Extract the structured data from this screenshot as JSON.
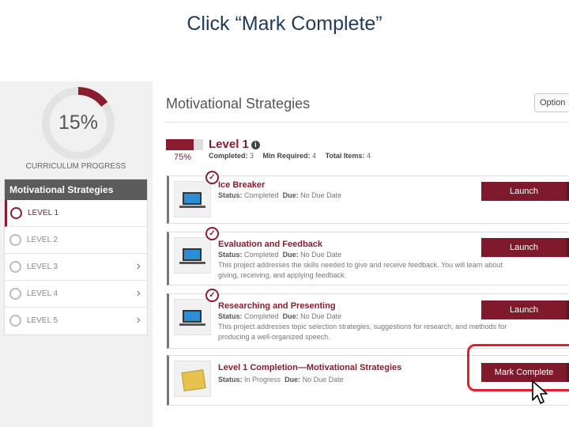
{
  "slide_title": "Click “Mark Complete”",
  "colors": {
    "accent": "#8a1c2f",
    "button": "#7e1a2c",
    "highlight": "#e0202f",
    "title": "#1f3a5b"
  },
  "progress": {
    "percent_label": "15%",
    "value": 0.15,
    "label": "CURRICULUM PROGRESS"
  },
  "sidebar": {
    "header": "Motivational Strategies",
    "levels": [
      {
        "label": "LEVEL 1",
        "active": true,
        "chevron": false
      },
      {
        "label": "LEVEL 2",
        "active": false,
        "chevron": false
      },
      {
        "label": "LEVEL 3",
        "active": false,
        "chevron": true
      },
      {
        "label": "LEVEL 4",
        "active": false,
        "chevron": true
      },
      {
        "label": "LEVEL 5",
        "active": false,
        "chevron": true
      }
    ]
  },
  "main": {
    "title": "Motivational Strategies",
    "options_label": "Option",
    "level": {
      "title": "Level 1",
      "percent_label": "75%",
      "fill": 0.75,
      "completed_label": "Completed:",
      "completed_value": "3",
      "min_label": "Min Required:",
      "min_value": "4",
      "total_label": "Total Items:",
      "total_value": "4"
    },
    "cards": [
      {
        "title": "Ice Breaker",
        "status_label": "Status:",
        "status": "Completed",
        "due_label": "Due:",
        "due": "No Due Date",
        "description": "",
        "button": "Launch",
        "icon": "laptop-icon"
      },
      {
        "title": "Evaluation and Feedback",
        "status_label": "Status:",
        "status": "Completed",
        "due_label": "Due:",
        "due": "No Due Date",
        "description": "This project addresses the skills needed to give and receive feedback. You will learn about giving, receiving, and applying feedback.",
        "button": "Launch",
        "icon": "laptop-icon"
      },
      {
        "title": "Researching and Presenting",
        "status_label": "Status:",
        "status": "Completed",
        "due_label": "Due:",
        "due": "No Due Date",
        "description": "This project addresses topic selection strategies, suggestions for research, and methods for producing a well-organized speech.",
        "button": "Launch",
        "icon": "laptop-icon"
      },
      {
        "title": "Level 1 Completion—Motivational Strategies",
        "status_label": "Status:",
        "status": "In Progress",
        "due_label": "Due:",
        "due": "No Due Date",
        "description": "",
        "button": "Mark Complete",
        "icon": "folder-icon"
      }
    ]
  }
}
